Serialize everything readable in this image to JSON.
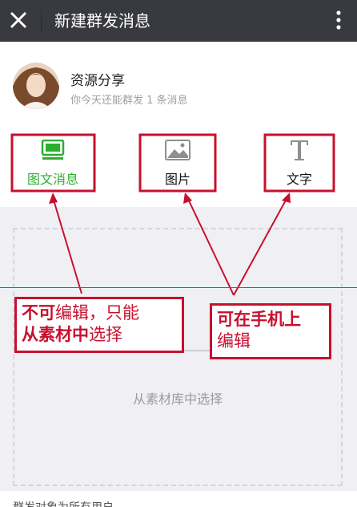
{
  "header": {
    "title": "新建群发消息"
  },
  "account": {
    "name": "资源分享",
    "quota_text": "你今天还能群发 1 条消息"
  },
  "tabs": [
    {
      "label": "图文消息",
      "icon": "news-icon",
      "color": "#2aae2e"
    },
    {
      "label": "图片",
      "icon": "image-icon",
      "color": "#111111"
    },
    {
      "label": "文字",
      "icon": "text-icon",
      "color": "#111111"
    }
  ],
  "content": {
    "pick_text": "从素材库中选择"
  },
  "annotations": {
    "left_line1_bold": "不可",
    "left_line1_rest": "编辑，只能",
    "left_line2_bold": "从素材中",
    "left_line2_rest": "选择",
    "right_line1": "可在手机上",
    "right_line2": "编辑"
  },
  "footer": {
    "text": "群发对象为所有用户"
  },
  "colors": {
    "accent": "#2aae2e",
    "annotation": "#c8102e",
    "topbar": "#393a3f"
  }
}
